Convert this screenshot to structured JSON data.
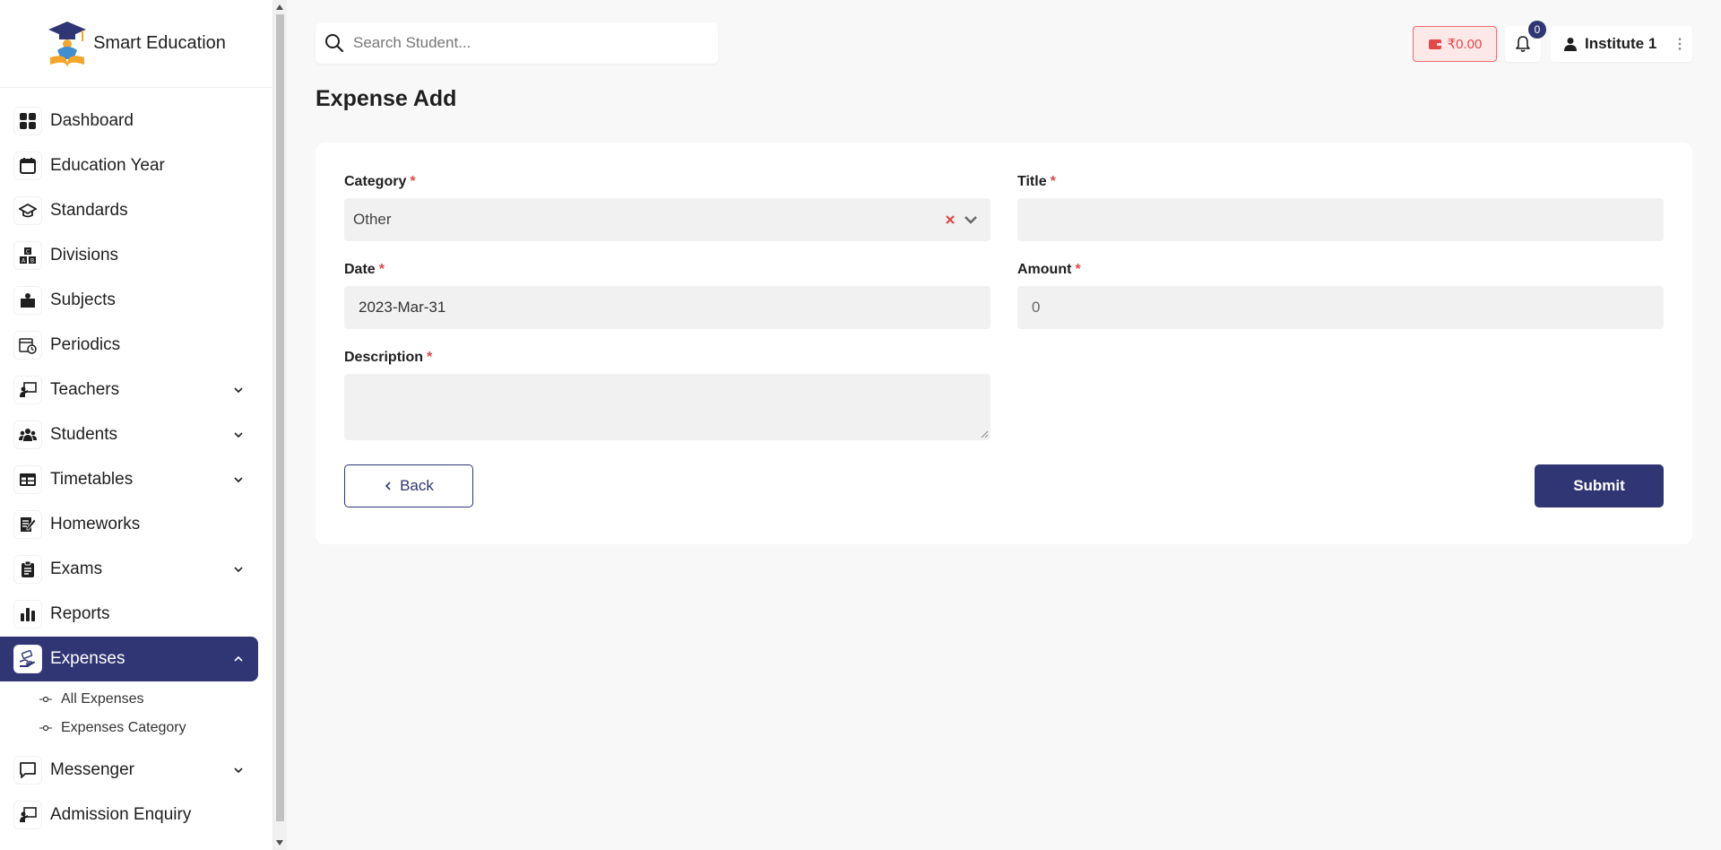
{
  "brand": {
    "name": "Smart Education",
    "logo_icon": "graduation-cap-logo"
  },
  "sidebar": {
    "items": [
      {
        "label": "Dashboard",
        "icon": "dashboard-grid-icon"
      },
      {
        "label": "Education Year",
        "icon": "calendar-icon"
      },
      {
        "label": "Standards",
        "icon": "graduation-hat-icon"
      },
      {
        "label": "Divisions",
        "icon": "abc-blocks-icon"
      },
      {
        "label": "Subjects",
        "icon": "books-icon"
      },
      {
        "label": "Periodics",
        "icon": "calendar-clock-icon"
      },
      {
        "label": "Teachers",
        "icon": "teacher-board-icon",
        "expandable": true
      },
      {
        "label": "Students",
        "icon": "students-group-icon",
        "expandable": true
      },
      {
        "label": "Timetables",
        "icon": "table-icon",
        "expandable": true
      },
      {
        "label": "Homeworks",
        "icon": "homework-pencil-icon"
      },
      {
        "label": "Exams",
        "icon": "clipboard-icon",
        "expandable": true
      },
      {
        "label": "Reports",
        "icon": "bar-chart-icon"
      },
      {
        "label": "Expenses",
        "icon": "hand-money-icon",
        "expandable": true,
        "active": true
      },
      {
        "label": "Messenger",
        "icon": "chat-bubble-icon",
        "expandable": true
      },
      {
        "label": "Admission Enquiry",
        "icon": "enquiry-board-icon"
      }
    ],
    "expenses_sub": [
      "All Expenses",
      "Expenses Category"
    ]
  },
  "search": {
    "placeholder": "Search Student..."
  },
  "wallet": {
    "amount": "₹0.00"
  },
  "notifications": {
    "count": "0"
  },
  "user": {
    "name": "Institute 1"
  },
  "page": {
    "title": "Expense Add"
  },
  "form": {
    "category": {
      "label": "Category",
      "value": "Other"
    },
    "title": {
      "label": "Title",
      "value": ""
    },
    "date": {
      "label": "Date",
      "value": "2023-Mar-31"
    },
    "amount": {
      "label": "Amount",
      "value": "0"
    },
    "description": {
      "label": "Description",
      "value": ""
    },
    "required_mark": "*",
    "back_label": "Back",
    "submit_label": "Submit"
  },
  "colors": {
    "primary": "#2f3673",
    "danger": "#e34848",
    "field_bg": "#f1f1f1"
  }
}
